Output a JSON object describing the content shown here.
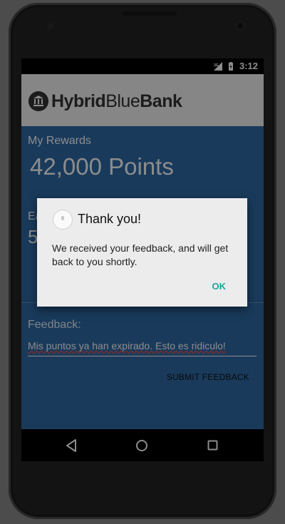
{
  "statusbar": {
    "network_icon": "signal-3g-icon",
    "battery_icon": "battery-charging-icon",
    "time": "3:12"
  },
  "header": {
    "logo_icon": "bank-building-icon",
    "brand_part1": "Hybrid",
    "brand_part2": "Blue",
    "brand_part3": "Bank"
  },
  "rewards": {
    "label": "My Rewards",
    "points": "42,000 Points"
  },
  "earned": {
    "label": "Ea",
    "value": "5"
  },
  "feedback": {
    "label": "Feedback:",
    "input_value": "Mis puntos ya han expirado. Esto es ridiculo!",
    "submit_label": "SUBMIT FEEDBACK"
  },
  "navbar": {
    "back_icon": "back-triangle-icon",
    "home_icon": "home-circle-icon",
    "recents_icon": "recents-square-icon"
  },
  "dialog": {
    "icon": "feedback-bubble-icon",
    "title": "Thank you!",
    "message": "We received your feedback, and will get back to you shortly.",
    "ok_label": "OK"
  },
  "colors": {
    "content_blue": "#2f6aa6",
    "accent_teal": "#1ba79c",
    "spellcheck_red": "#e05050"
  }
}
